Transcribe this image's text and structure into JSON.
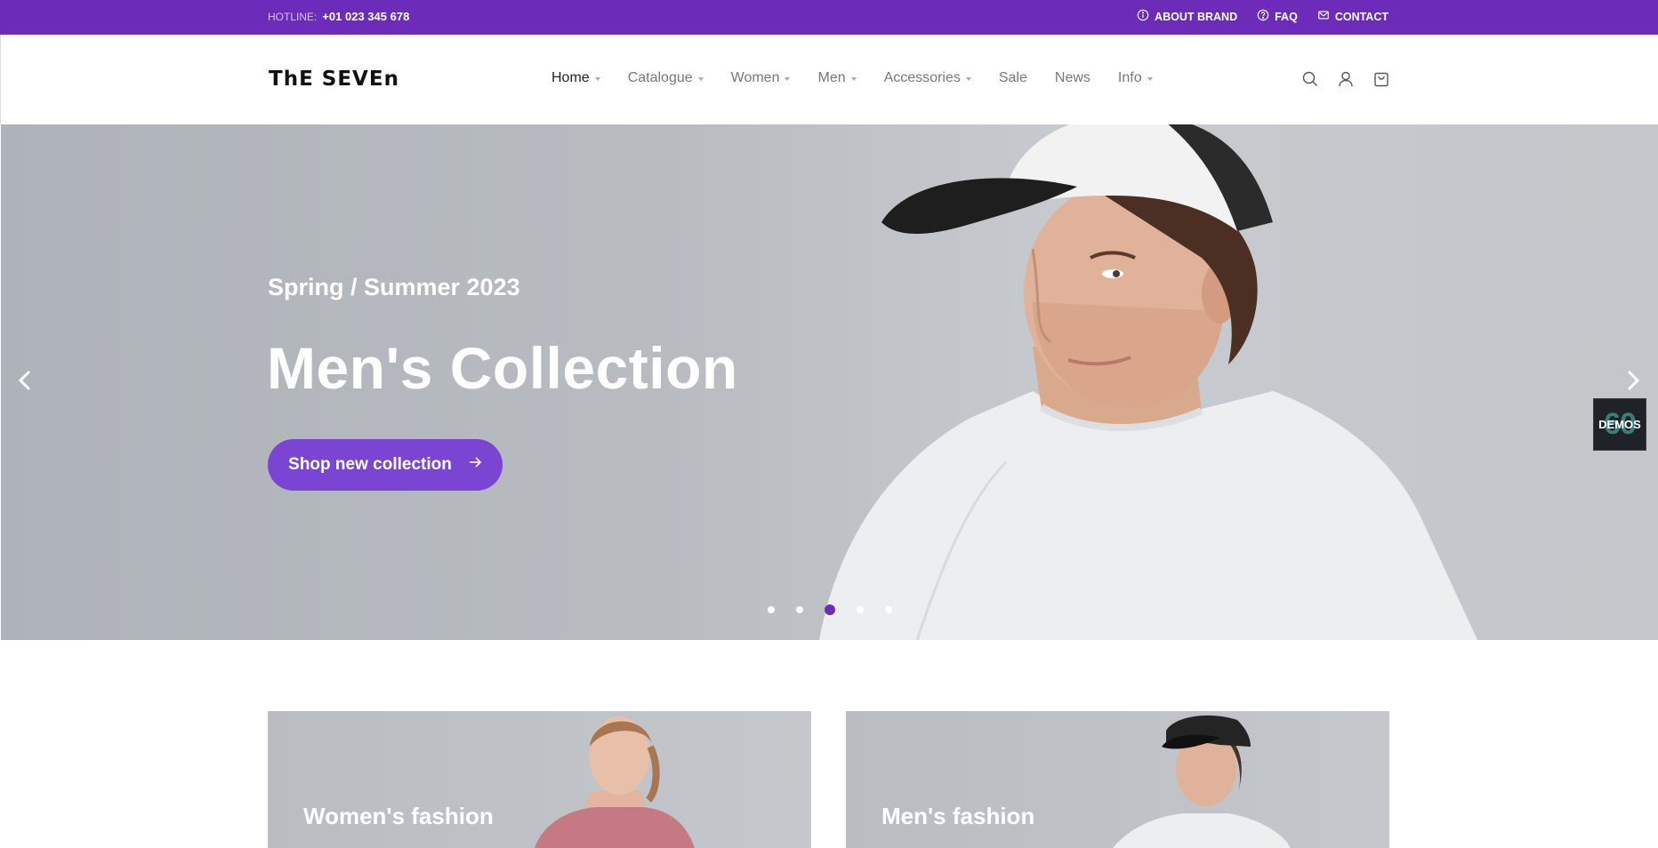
{
  "topbar": {
    "hotline_label": "HOTLINE:",
    "hotline_number": "+01 023 345 678",
    "links": [
      {
        "label": "ABOUT BRAND",
        "icon": "info-icon"
      },
      {
        "label": "FAQ",
        "icon": "question-icon"
      },
      {
        "label": "CONTACT",
        "icon": "mail-icon"
      }
    ],
    "bg_color": "#6c2bb9"
  },
  "header": {
    "logo": "ThE SEVEn",
    "nav": [
      {
        "label": "Home",
        "dropdown": true,
        "active": true
      },
      {
        "label": "Catalogue",
        "dropdown": true
      },
      {
        "label": "Women",
        "dropdown": true
      },
      {
        "label": "Men",
        "dropdown": true
      },
      {
        "label": "Accessories",
        "dropdown": true
      },
      {
        "label": "Sale",
        "dropdown": false
      },
      {
        "label": "News",
        "dropdown": false
      },
      {
        "label": "Info",
        "dropdown": true
      }
    ],
    "icons": [
      "search-icon",
      "user-icon",
      "cart-icon"
    ]
  },
  "hero": {
    "subtitle": "Spring / Summer 2023",
    "title": "Men's Collection",
    "cta_label": "Shop new collection",
    "slide_count": 5,
    "active_slide": 3,
    "accent_color": "#7b45d4"
  },
  "demos": {
    "number": "60",
    "label": "DEMOS"
  },
  "categories": [
    {
      "label": "Women's fashion"
    },
    {
      "label": "Men's fashion"
    }
  ]
}
